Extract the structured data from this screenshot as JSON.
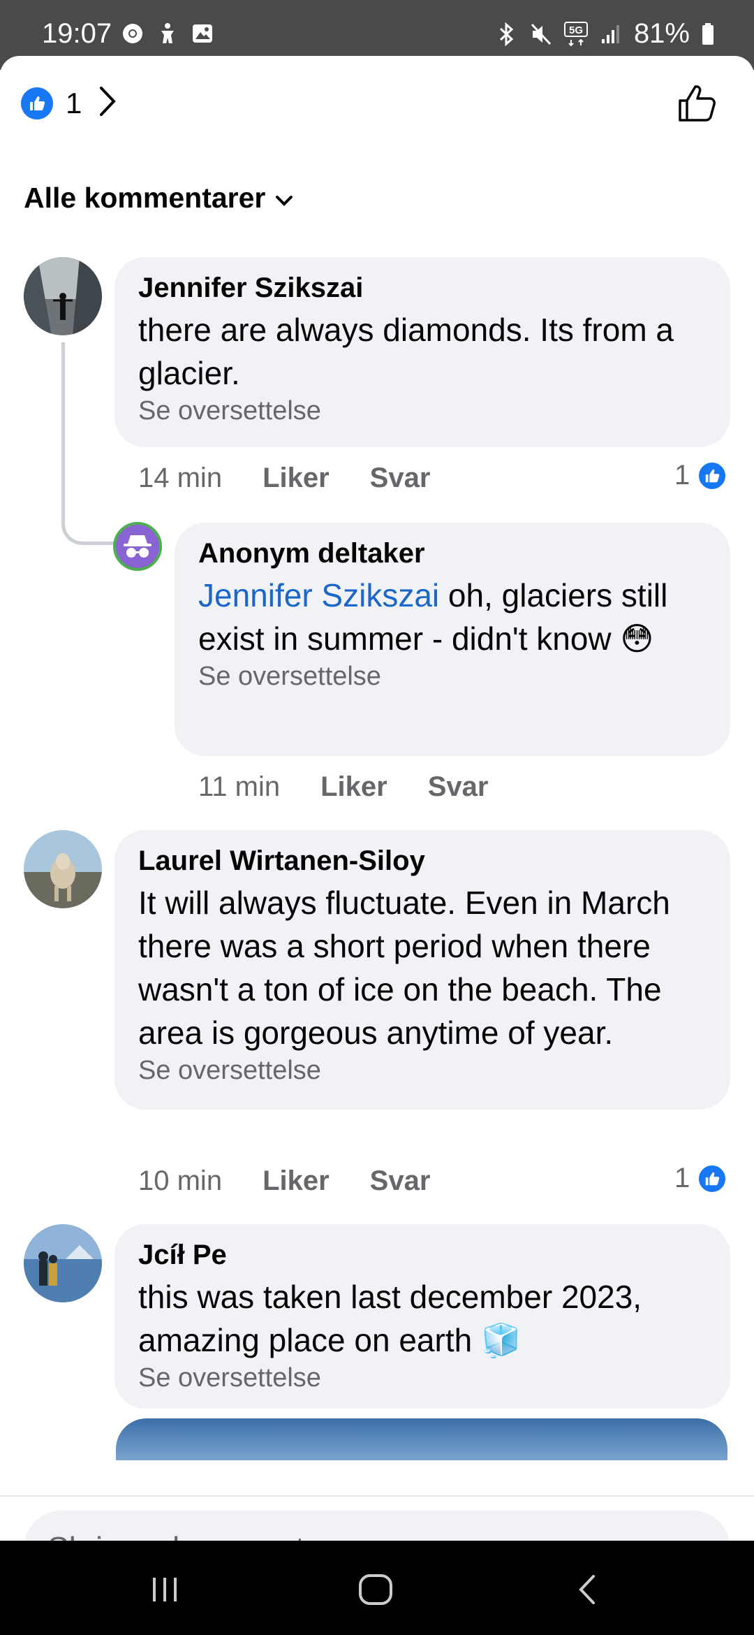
{
  "status_bar": {
    "time": "19:07",
    "battery": "81%",
    "network": "5G",
    "left_icons": [
      "chrome-icon",
      "accessibility-icon",
      "gallery-icon"
    ],
    "right_icons": [
      "bluetooth-icon",
      "mute-icon",
      "5g-icon",
      "signal-icon",
      "battery-icon"
    ]
  },
  "header": {
    "reaction_count": "1",
    "sort_label": "Alle kommentarer"
  },
  "comments": [
    {
      "name": "Jennifer Szikszai",
      "text": "there are always diamonds. Its from a glacier.",
      "translate": "Se oversettelse",
      "time": "14 min",
      "like": "Liker",
      "reply": "Svar",
      "reactions": "1"
    },
    {
      "name": "Anonym deltaker",
      "mention": "Jennifer Szikszai",
      "text": " oh, glaciers still exist in summer - didn't know 😳",
      "translate": "Se oversettelse",
      "time": "11 min",
      "like": "Liker",
      "reply": "Svar"
    },
    {
      "name": "Laurel Wirtanen-Siloy",
      "text": "It will always fluctuate. Even in March there was a short period when there wasn't a ton of ice on the beach.  The area is gorgeous anytime of year.",
      "translate": "Se oversettelse",
      "time": "10 min",
      "like": "Liker",
      "reply": "Svar",
      "reactions": "1"
    },
    {
      "name": "Jcíł Pe",
      "text": "this was taken last december 2023, amazing place on earth 🧊",
      "translate": "Se oversettelse"
    }
  ],
  "composer": {
    "placeholder": "Skriv en kommentar …"
  },
  "colors": {
    "facebook_blue": "#1877f2",
    "bubble_bg": "#f0f2f5",
    "secondary_text": "#65676b",
    "mention": "#1a67c9"
  }
}
